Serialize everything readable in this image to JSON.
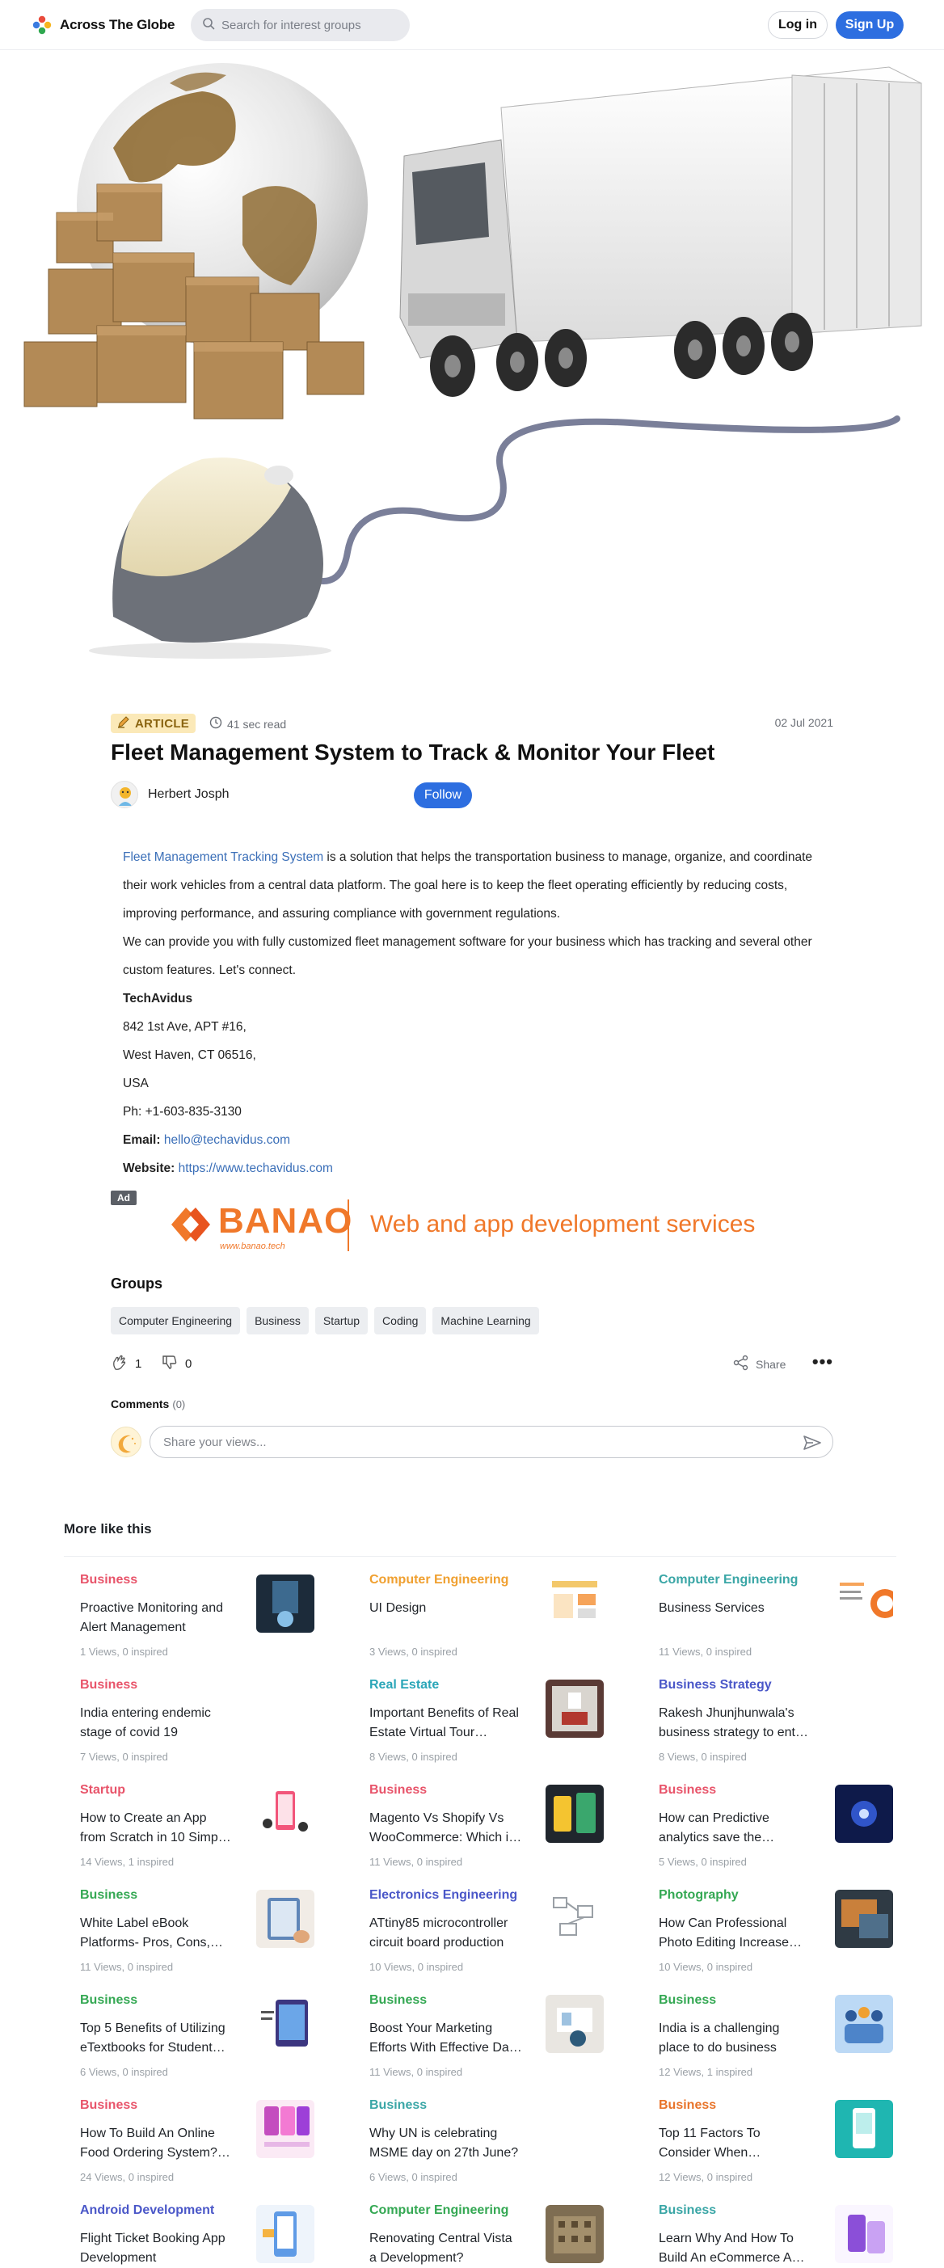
{
  "header": {
    "brand": "Across The Globe",
    "search_placeholder": "Search for interest groups",
    "login": "Log in",
    "signup": "Sign Up"
  },
  "article": {
    "badge": "ARTICLE",
    "read_time": "41 sec read",
    "date": "02 Jul 2021",
    "title": "Fleet Management System to Track & Monitor Your Fleet",
    "author": "Herbert Josph",
    "follow": "Follow",
    "link_text": "Fleet Management Tracking System",
    "p1_rest": " is a solution that helps the transportation business to manage, organize, and coordinate their work vehicles from a central data platform. The goal here is to keep the fleet operating efficiently by reducing costs, improving performance, and assuring compliance with government regulations.",
    "p2": "We can provide you with fully customized fleet management software for your business which has tracking and several other custom features. Let's connect.",
    "company": "TechAvidus",
    "addr1": "842 1st Ave, APT #16,",
    "addr2": "West Haven, CT 06516,",
    "addr3": "USA",
    "phone": "Ph: +1-603-835-3130",
    "email_label": "Email:",
    "email": "hello@techavidus.com",
    "website_label": "Website:",
    "website": "https://www.techavidus.com"
  },
  "ad": {
    "tag": "Ad",
    "brand": "BANAO",
    "brand_url": "www.banao.tech",
    "tagline": "Web and app development services"
  },
  "groups": {
    "heading": "Groups",
    "items": [
      "Computer Engineering",
      "Business",
      "Startup",
      "Coding",
      "Machine Learning"
    ]
  },
  "reactions": {
    "likes": "1",
    "dislikes": "0",
    "share": "Share"
  },
  "comments": {
    "label": "Comments",
    "count": "(0)",
    "placeholder": "Share your views..."
  },
  "more_like_this": {
    "heading": "More like this",
    "cards": [
      {
        "category": "Business",
        "color": "#e8546a",
        "title": "Proactive Monitoring and Alert Management",
        "stats": "1 Views, 0 inspired",
        "thumb": "dark-tech"
      },
      {
        "category": "Computer Engineering",
        "color": "#f0a030",
        "title": "UI Design",
        "stats": "3 Views, 0 inspired",
        "thumb": "ui-doc"
      },
      {
        "category": "Computer Engineering",
        "color": "#3aa6a6",
        "title": "Business Services",
        "stats": "11 Views, 0 inspired",
        "thumb": "orange-doc"
      },
      {
        "category": "Business",
        "color": "#e8546a",
        "title": "India entering endemic stage of covid 19",
        "stats": "7 Views, 0 inspired",
        "thumb": "none"
      },
      {
        "category": "Real Estate",
        "color": "#2aa6b8",
        "title": "Important Benefits of Real Estate Virtual Tour…",
        "stats": "8 Views, 0 inspired",
        "thumb": "room"
      },
      {
        "category": "Business Strategy",
        "color": "#4a57c8",
        "title": "Rakesh Jhunjhunwala's business strategy to ent…",
        "stats": "8 Views, 0 inspired",
        "thumb": "none"
      },
      {
        "category": "Startup",
        "color": "#e8546a",
        "title": "How to Create an App from Scratch in 10 Simp…",
        "stats": "14 Views, 1 inspired",
        "thumb": "phone-pink"
      },
      {
        "category": "Business",
        "color": "#e8546a",
        "title": "Magento Vs Shopify Vs WooCommerce: Which i…",
        "stats": "11 Views, 0 inspired",
        "thumb": "phone-dark"
      },
      {
        "category": "Business",
        "color": "#e8546a",
        "title": "How can Predictive analytics save the…",
        "stats": "5 Views, 0 inspired",
        "thumb": "blue-glow"
      },
      {
        "category": "Business",
        "color": "#34a853",
        "title": "White Label eBook Platforms- Pros, Cons,…",
        "stats": "11 Views, 0 inspired",
        "thumb": "tablet-hand"
      },
      {
        "category": "Electronics Engineering",
        "color": "#4a57c8",
        "title": "ATtiny85 microcontroller circuit board production",
        "stats": "10 Views, 0 inspired",
        "thumb": "circuit"
      },
      {
        "category": "Photography",
        "color": "#34a853",
        "title": "How Can Professional Photo Editing Increase…",
        "stats": "10 Views, 0 inspired",
        "thumb": "photo"
      },
      {
        "category": "Business",
        "color": "#34a853",
        "title": "Top 5 Benefits of Utilizing eTextbooks for Student…",
        "stats": "6 Views, 0 inspired",
        "thumb": "etextbook"
      },
      {
        "category": "Business",
        "color": "#34a853",
        "title": "Boost Your Marketing Efforts With Effective Da…",
        "stats": "11 Views, 0 inspired",
        "thumb": "marketing"
      },
      {
        "category": "Business",
        "color": "#34a853",
        "title": "India is a challenging place to do business",
        "stats": "12 Views, 1 inspired",
        "thumb": "people-blue"
      },
      {
        "category": "Business",
        "color": "#e8546a",
        "title": "How To Build An Online Food Ordering System?…",
        "stats": "24 Views, 0 inspired",
        "thumb": "food-app"
      },
      {
        "category": "Business",
        "color": "#3aa6a6",
        "title": "Why UN is celebrating MSME day on 27th June?",
        "stats": "6 Views, 0 inspired",
        "thumb": "none"
      },
      {
        "category": "Business",
        "color": "#e8742a",
        "title": "Top 11 Factors To Consider When…",
        "stats": "12 Views, 0 inspired",
        "thumb": "teal-app"
      },
      {
        "category": "Android Development",
        "color": "#4a57c8",
        "title": "Flight Ticket Booking App Development",
        "stats": "",
        "thumb": "flight-app"
      },
      {
        "category": "Computer Engineering",
        "color": "#34a853",
        "title": "Renovating Central Vista a Development?",
        "stats": "",
        "thumb": "building"
      },
      {
        "category": "Business",
        "color": "#3aa6a6",
        "title": "Learn Why And How To Build An eCommerce A…",
        "stats": "",
        "thumb": "purple-app"
      }
    ]
  }
}
